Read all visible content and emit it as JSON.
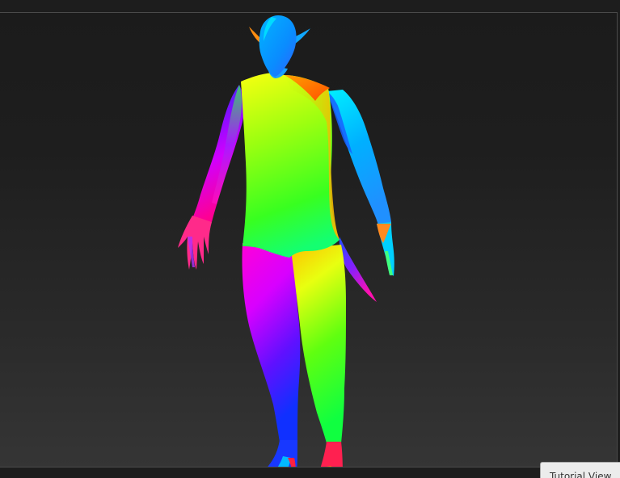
{
  "tutorial_tab": {
    "label": "Tutorial View"
  },
  "model": {
    "icon": "character-mesh",
    "shading": "normal-map",
    "colors": {
      "cyan": "#00d8ff",
      "blue": "#1e3cff",
      "magenta": "#ff00d0",
      "green": "#30ff30",
      "yellow": "#f5ff20",
      "orange": "#ff8a00",
      "red": "#ff2020"
    }
  },
  "viewport": {
    "background_top": "#1b1b1b",
    "background_bottom": "#353535"
  }
}
